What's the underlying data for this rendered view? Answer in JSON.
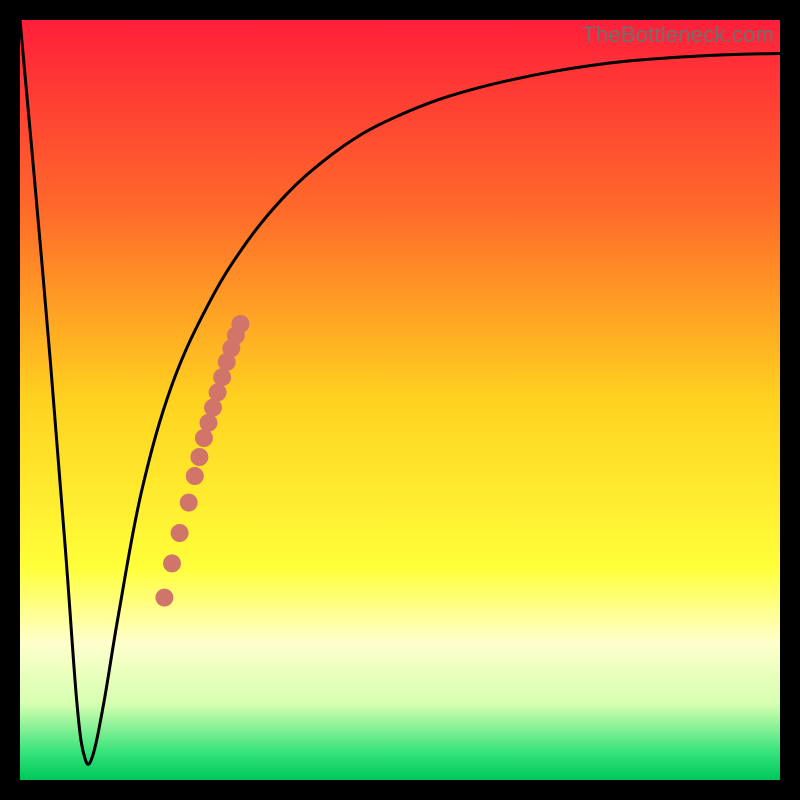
{
  "watermark": "TheBottleneck.com",
  "chart_data": {
    "type": "line",
    "title": "",
    "xlabel": "",
    "ylabel": "",
    "xlim": [
      0,
      100
    ],
    "ylim": [
      0,
      100
    ],
    "grid": false,
    "legend": false,
    "background_gradient": {
      "stops": [
        {
          "pos": 0.0,
          "color": "#ff1f3a"
        },
        {
          "pos": 0.25,
          "color": "#ff6a2a"
        },
        {
          "pos": 0.5,
          "color": "#ffd21f"
        },
        {
          "pos": 0.72,
          "color": "#ffff3a"
        },
        {
          "pos": 0.82,
          "color": "#ffffcc"
        },
        {
          "pos": 0.9,
          "color": "#d6ffb0"
        },
        {
          "pos": 0.965,
          "color": "#32e27a"
        },
        {
          "pos": 1.0,
          "color": "#00c85a"
        }
      ]
    },
    "series": [
      {
        "name": "bottleneck-curve",
        "color": "#000000",
        "x": [
          0,
          2,
          4,
          6,
          7.5,
          8.5,
          9.5,
          11,
          13,
          16,
          20,
          25,
          30,
          35,
          40,
          45,
          50,
          55,
          60,
          65,
          70,
          75,
          80,
          85,
          90,
          95,
          100
        ],
        "y": [
          100,
          78,
          55,
          30,
          10,
          3,
          3,
          10,
          22,
          38,
          52,
          63,
          71,
          77,
          81.5,
          85,
          87.5,
          89.5,
          91,
          92.2,
          93.2,
          94,
          94.6,
          95,
          95.3,
          95.5,
          95.6
        ]
      }
    ],
    "scatter": {
      "name": "highlight-dots",
      "color": "#d1756b",
      "points_xy": [
        [
          19.0,
          24.0
        ],
        [
          20.0,
          28.5
        ],
        [
          21.0,
          32.5
        ],
        [
          22.2,
          36.5
        ],
        [
          23.0,
          40.0
        ],
        [
          23.6,
          42.5
        ],
        [
          24.2,
          45.0
        ],
        [
          24.8,
          47.0
        ],
        [
          25.4,
          49.0
        ],
        [
          26.0,
          51.0
        ],
        [
          26.6,
          53.0
        ],
        [
          27.2,
          55.0
        ],
        [
          27.8,
          56.8
        ],
        [
          28.4,
          58.5
        ],
        [
          29.0,
          60.0
        ]
      ],
      "radius": 9
    }
  }
}
